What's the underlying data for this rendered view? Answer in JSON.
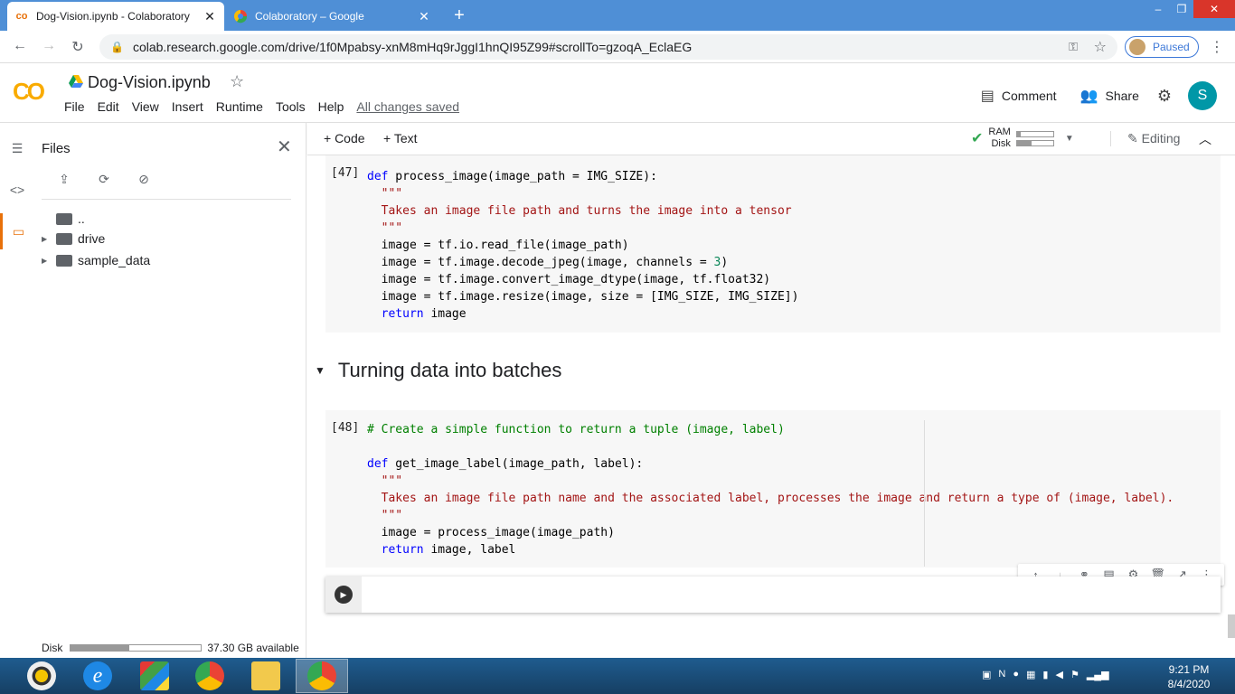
{
  "browser": {
    "tabs": [
      {
        "title": "Dog-Vision.ipynb - Colaboratory",
        "close": "✕"
      },
      {
        "title": "Colaboratory – Google",
        "close": "✕"
      }
    ],
    "new_tab": "+",
    "window_controls": {
      "minimize": "–",
      "maximize": "❐",
      "close": "✕"
    },
    "nav": {
      "back": "←",
      "forward": "→",
      "reload": "↻"
    },
    "url": "colab.research.google.com/drive/1f0Mpabsy-xnM8mHq9rJggI1hnQI95Z99#scrollTo=gzoqA_EclaEG",
    "profile_status": "Paused",
    "menu": "⋮"
  },
  "colab": {
    "logo": "CO",
    "notebook_title": "Dog-Vision.ipynb",
    "star": "☆",
    "menu": [
      "File",
      "Edit",
      "View",
      "Insert",
      "Runtime",
      "Tools",
      "Help"
    ],
    "save_status": "All changes saved",
    "comment_label": "Comment",
    "share_label": "Share",
    "avatar_initial": "S",
    "colors": {
      "accent": "#f9ab00",
      "avatar": "#0097a7",
      "sidebar_selected": "#e8710a"
    }
  },
  "sidebar": {
    "title": "Files",
    "close": "✕",
    "tree": [
      {
        "label": "..",
        "expandable": false
      },
      {
        "label": "drive",
        "expandable": true
      },
      {
        "label": "sample_data",
        "expandable": true
      }
    ],
    "disk_label": "Disk",
    "disk_available": "37.30 GB available",
    "disk_used_fraction": 0.45
  },
  "toolbar": {
    "add_code": "+ Code",
    "add_text": "+ Text",
    "ram_label": "RAM",
    "disk_label": "Disk",
    "ram_fraction": 0.1,
    "disk_fraction": 0.4,
    "editing_label": "Editing"
  },
  "cells": [
    {
      "exec_count": "[47]",
      "lines": [
        "def process_image(image_path = IMG_SIZE):",
        "  \"\"\"",
        "  Takes an image file path and turns the image into a tensor",
        "  \"\"\"",
        "  image = tf.io.read_file(image_path)",
        "  image = tf.image.decode_jpeg(image, channels = 3)",
        "  image = tf.image.convert_image_dtype(image, tf.float32)",
        "  image = tf.image.resize(image, size = [IMG_SIZE, IMG_SIZE])",
        "  return image"
      ]
    },
    {
      "exec_count": "[48]",
      "lines": [
        "# Create a simple function to return a tuple (image, label)",
        "",
        "def get_image_label(image_path, label):",
        "  \"\"\"",
        "  Takes an image file path name and the associated label, processes the image and return a type of (image, label).",
        "  \"\"\"",
        "  image = process_image(image_path)",
        "  return image, label"
      ]
    }
  ],
  "section_heading": "Turning data into batches",
  "taskbar": {
    "time": "9:21 PM",
    "date": "8/4/2020"
  }
}
